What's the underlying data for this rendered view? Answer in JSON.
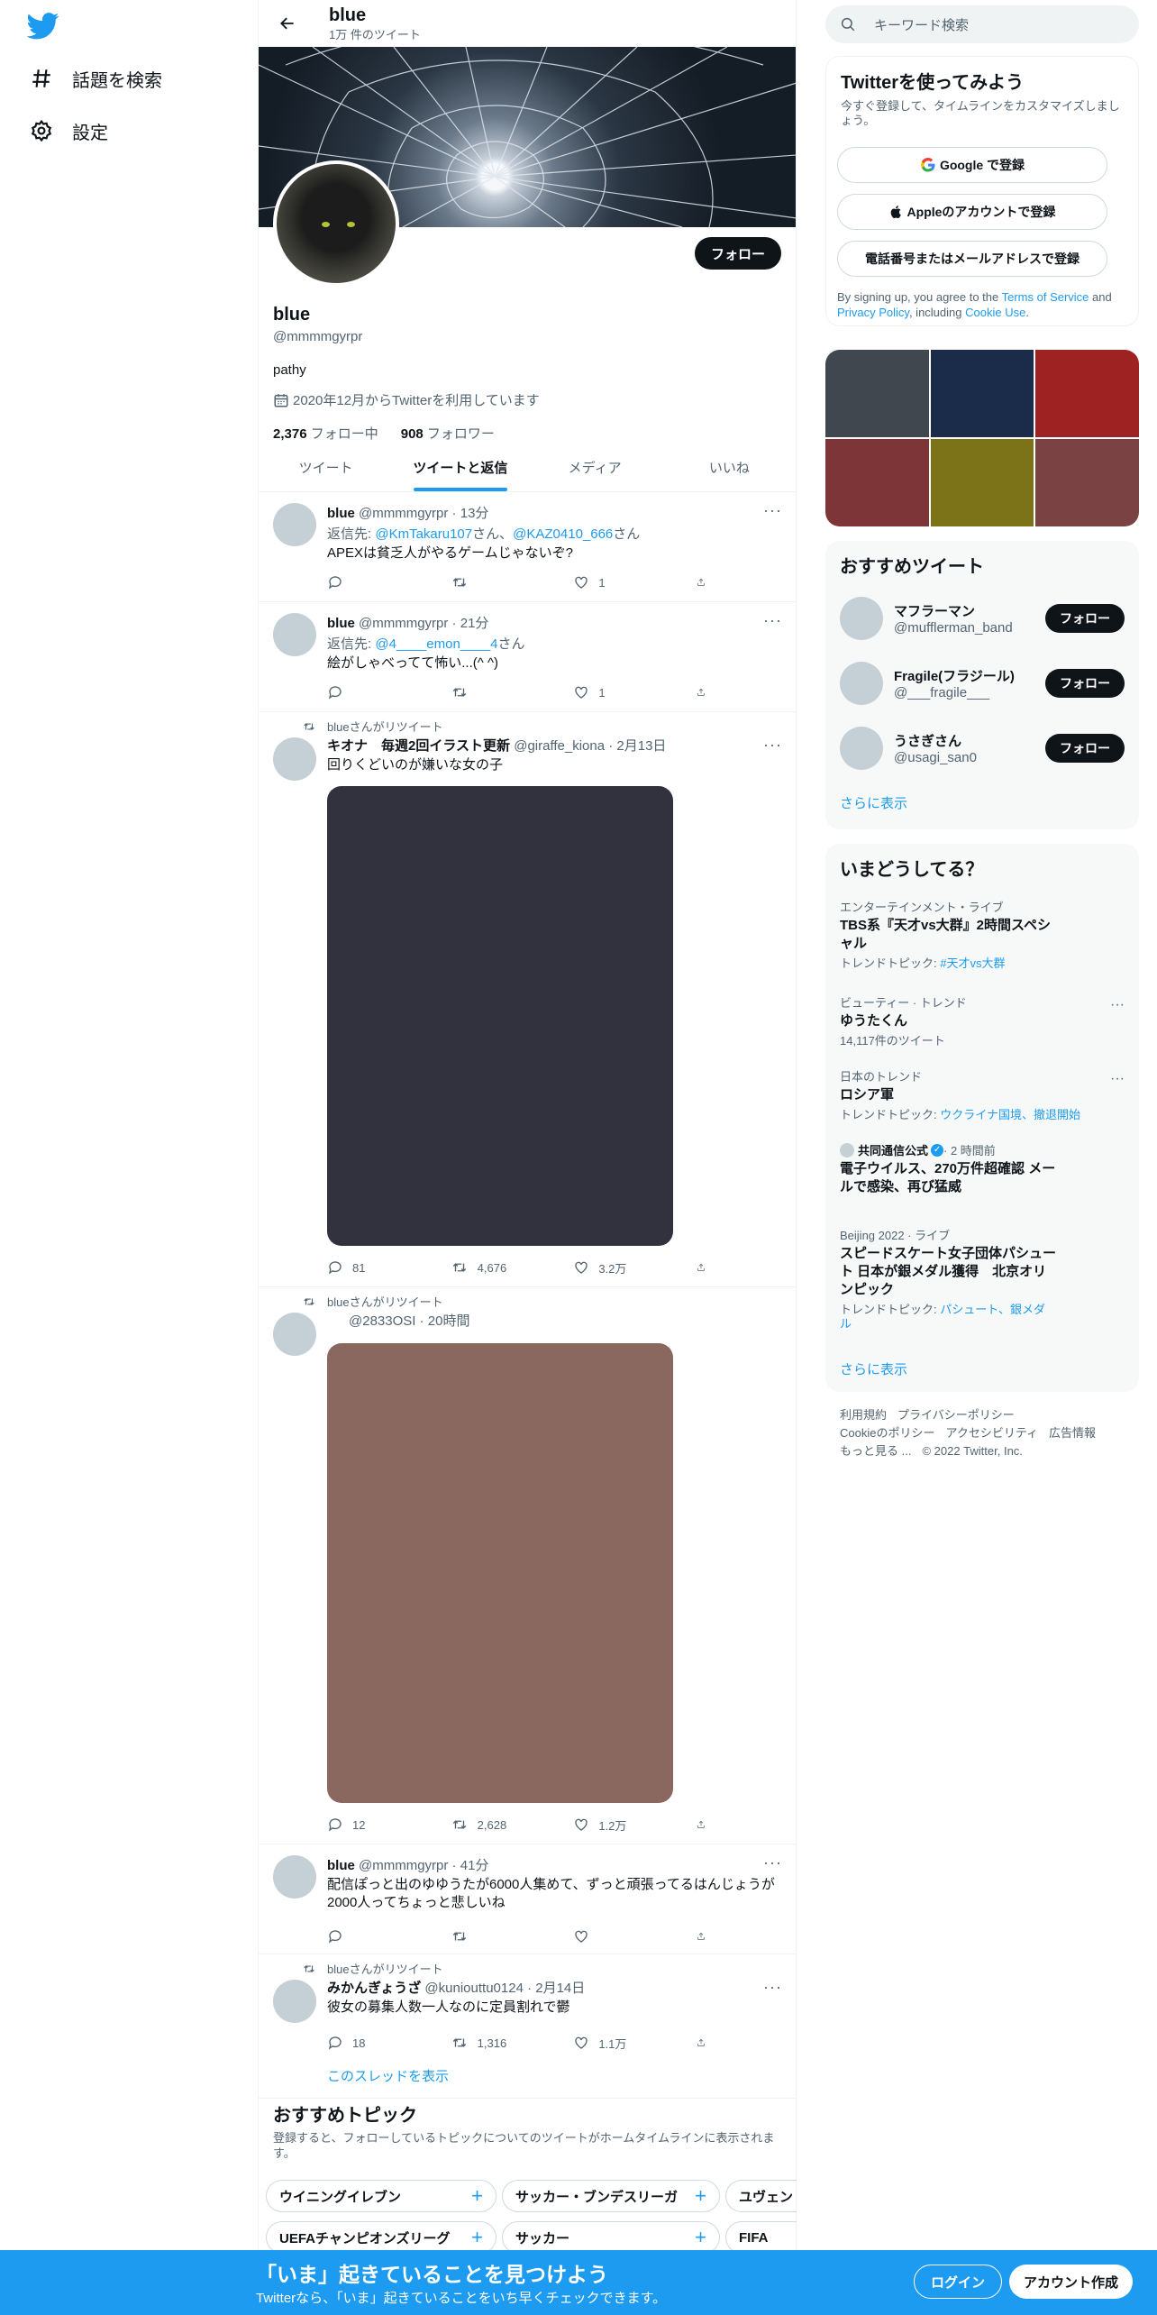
{
  "nav": {
    "explore": "話題を検索",
    "settings": "設定"
  },
  "profile": {
    "name": "blue",
    "tweet_count": "1万 件のツイート",
    "handle": "@mmmmgyrpr",
    "bio": "pathy",
    "joined": "2020年12月からTwitterを利用しています",
    "following_count": "2,376",
    "following_label": " フォロー中",
    "followers_count": "908",
    "followers_label": " フォロワー",
    "follow_button": "フォロー"
  },
  "tabs": [
    "ツイート",
    "ツイートと返信",
    "メディア",
    "いいね"
  ],
  "tweets": [
    {
      "name": "blue",
      "meta": " @mmmmgyrpr · 13分",
      "reply_prefix": "返信先: ",
      "reply_to1": "@KmTakaru107",
      "reply_mid": "さん、",
      "reply_to2": "@KAZ0410_666",
      "reply_suffix": "さん",
      "text": "APEXは貧乏人がやるゲームじゃないぞ?",
      "replies": "",
      "retweets": "",
      "likes": "1"
    },
    {
      "name": "blue",
      "meta": " @mmmmgyrpr · 21分",
      "reply_prefix": "返信先: ",
      "reply_to1": "@4____emon____4",
      "reply_suffix": "さん",
      "text": "絵がしゃべってて怖い...(^ ^)",
      "replies": "",
      "retweets": "",
      "likes": "1"
    },
    {
      "retweeted_by": "blueさんがリツイート",
      "name": "キオナ　毎週2回イラスト更新",
      "meta": " @giraffe_kiona · 2月13日",
      "text": "回りくどいのが嫌いな女の子",
      "replies": "81",
      "retweets": "4,676",
      "likes": "3.2万"
    },
    {
      "retweeted_by": "blueさんがリツイート",
      "name": "",
      "meta": "@2833OSI · 20時間",
      "replies": "12",
      "retweets": "2,628",
      "likes": "1.2万"
    },
    {
      "name": "blue",
      "meta": " @mmmmgyrpr · 41分",
      "text": "配信ぽっと出のゆゆうたが6000人集めて、ずっと頑張ってるはんじょうが2000人ってちょっと悲しいね",
      "replies": "",
      "retweets": "",
      "likes": ""
    },
    {
      "retweeted_by": "blueさんがリツイート",
      "name": "みかんぎょうざ",
      "meta": " @kuniouttu0124 · 2月14日",
      "text": "彼女の募集人数一人なのに定員割れで鬱",
      "replies": "18",
      "retweets": "1,316",
      "likes": "1.1万",
      "thread_link": "このスレッドを表示"
    }
  ],
  "topics": {
    "title": "おすすめトピック",
    "desc": "登録すると、フォローしているトピックについてのツイートがホームタイムラインに表示されます。",
    "chips": [
      "ウイニングイレブン",
      "サッカー・ブンデスリーガ",
      "ユヴェントス",
      "UEFAチャンピオンズリーグ",
      "サッカー",
      "FIFA"
    ]
  },
  "search": {
    "placeholder": "キーワード検索"
  },
  "signup": {
    "title": "Twitterを使ってみよう",
    "sub": "今すぐ登録して、タイムラインをカスタマイズしましょう。",
    "google": "Google で登録",
    "apple": "Appleのアカウントで登録",
    "phone": "電話番号またはメールアドレスで登録",
    "legal_1": "By signing up, you agree to the ",
    "tos": "Terms of Service",
    "legal_2": " and ",
    "privacy": "Privacy Policy",
    "legal_3": ", including ",
    "cookie": "Cookie Use",
    "legal_4": "."
  },
  "media_colors": [
    "#40474f",
    "#1b2c4b",
    "#9e2222",
    "#7d3538",
    "#7c7218",
    "#7a4242"
  ],
  "who_to_follow": {
    "title": "おすすめツイート",
    "users": [
      {
        "name": "マフラーマン",
        "handle": "@mufflerman_band",
        "button": "フォロー"
      },
      {
        "name": "Fragile(フラジール)",
        "handle": "@___fragile___",
        "button": "フォロー"
      },
      {
        "name": "うさぎさん",
        "handle": "@usagi_san0",
        "button": "フォロー"
      }
    ],
    "more": "さらに表示"
  },
  "trends": {
    "title": "いまどうしてる？",
    "items": [
      {
        "context": "エンターテインメント・ライブ",
        "title": "TBS系『天才vs大群』2時間スペシャル",
        "meta_prefix": "トレンドトピック: ",
        "meta_link": "#天才vs大群"
      },
      {
        "context": "ビューティー · トレンド",
        "title": "ゆうたくん",
        "meta": "14,117件のツイート"
      },
      {
        "context": "日本のトレンド",
        "title": "ロシア軍",
        "meta_prefix": "トレンドトピック: ",
        "meta_link": "ウクライナ国境、撤退開始"
      },
      {
        "context": "共同通信公式",
        "context_meta": " · 2 時間前",
        "title": "電子ウイルス、270万件超確認 メールで感染、再び猛威"
      },
      {
        "context": "Beijing 2022 · ライブ",
        "title": "スピードスケート女子団体パシュート 日本が銀メダル獲得　北京オリンピック",
        "meta_prefix": "トレンドトピック: ",
        "meta_link": "パシュート、銀メダル"
      }
    ],
    "more": "さらに表示"
  },
  "footer": {
    "links": [
      "利用規約",
      "プライバシーポリシー",
      "Cookieのポリシー",
      "アクセシビリティ",
      "広告情報",
      "もっと見る ..."
    ],
    "copyright": "© 2022 Twitter, Inc."
  },
  "bottom_bar": {
    "title": "「いま」起きていることを見つけよう",
    "sub": "Twitterなら、「いま」起きていることをいち早くチェックできます。",
    "login": "ログイン",
    "signup": "アカウント作成"
  },
  "colors": {
    "accent": "#1d9bf0",
    "dark": "#0f1419",
    "muted": "#536471"
  }
}
